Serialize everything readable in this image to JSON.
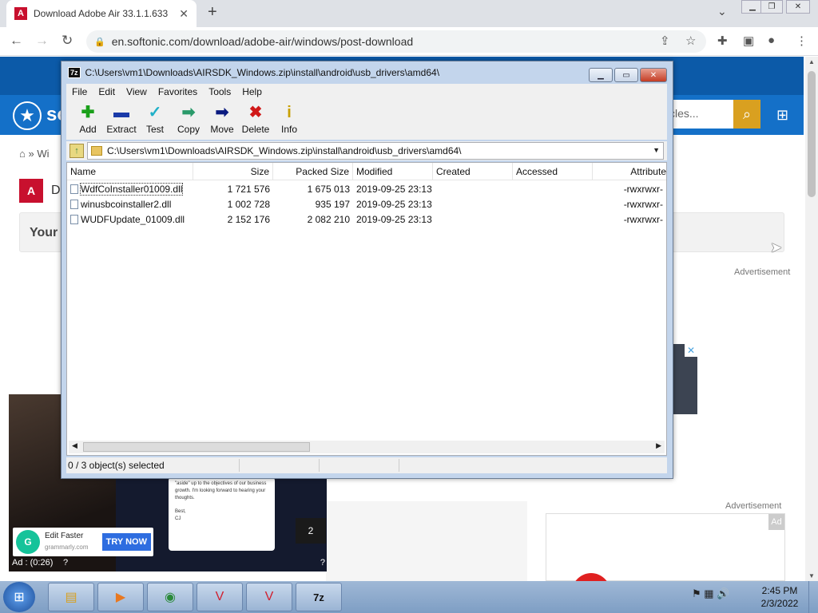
{
  "browser": {
    "tab_title": "Download Adobe Air 33.1.1.633",
    "url": "en.softonic.com/download/adobe-air/windows/post-download"
  },
  "site": {
    "name_partial": "so",
    "search_placeholder": "cles...",
    "breadcrumb": "» Wi",
    "product_title_partial": "D",
    "box_title_partial": "Your",
    "advertisement_1": "Advertisement",
    "advertisement_2": "Advertisement",
    "ad_tag": "Ad"
  },
  "video_ad": {
    "doc_line1": "\"aside\" up to the objectives of our business growth. I'm looking forward to hearing your thoughts.",
    "doc_line2": "Best,",
    "doc_line3": "CJ",
    "counter": "2",
    "brand_title": "Edit Faster",
    "brand_domain": "grammarly.com",
    "cta": "TRY NOW",
    "timer": "Ad : (0:26)",
    "help": "?"
  },
  "zip": {
    "title": "C:\\Users\\vm1\\Downloads\\AIRSDK_Windows.zip\\install\\android\\usb_drivers\\amd64\\",
    "menu": [
      "File",
      "Edit",
      "View",
      "Favorites",
      "Tools",
      "Help"
    ],
    "tools": [
      {
        "label": "Add",
        "color": "#1aa01a",
        "glyph": "✚"
      },
      {
        "label": "Extract",
        "color": "#1a3aa8",
        "glyph": "▬"
      },
      {
        "label": "Test",
        "color": "#20b0c8",
        "glyph": "✓"
      },
      {
        "label": "Copy",
        "color": "#2a9a6a",
        "glyph": "➡"
      },
      {
        "label": "Move",
        "color": "#0a1a80",
        "glyph": "➡"
      },
      {
        "label": "Delete",
        "color": "#d01818",
        "glyph": "✖"
      },
      {
        "label": "Info",
        "color": "#c8a000",
        "glyph": "i"
      }
    ],
    "path": "C:\\Users\\vm1\\Downloads\\AIRSDK_Windows.zip\\install\\android\\usb_drivers\\amd64\\",
    "columns": [
      "Name",
      "Size",
      "Packed Size",
      "Modified",
      "Created",
      "Accessed",
      "Attribute"
    ],
    "files": [
      {
        "name": "WdfCoInstaller01009.dll",
        "size": "1 721 576",
        "packed": "1 675 013",
        "modified": "2019-09-25 23:13",
        "attr": "-rwxrwxr-"
      },
      {
        "name": "winusbcoinstaller2.dll",
        "size": "1 002 728",
        "packed": "935 197",
        "modified": "2019-09-25 23:13",
        "attr": "-rwxrwxr-"
      },
      {
        "name": "WUDFUpdate_01009.dll",
        "size": "2 152 176",
        "packed": "2 082 210",
        "modified": "2019-09-25 23:13",
        "attr": "-rwxrwxr-"
      }
    ],
    "status": "0 / 3 object(s) selected"
  },
  "taskbar": {
    "time": "2:45 PM",
    "date": "2/3/2022"
  }
}
